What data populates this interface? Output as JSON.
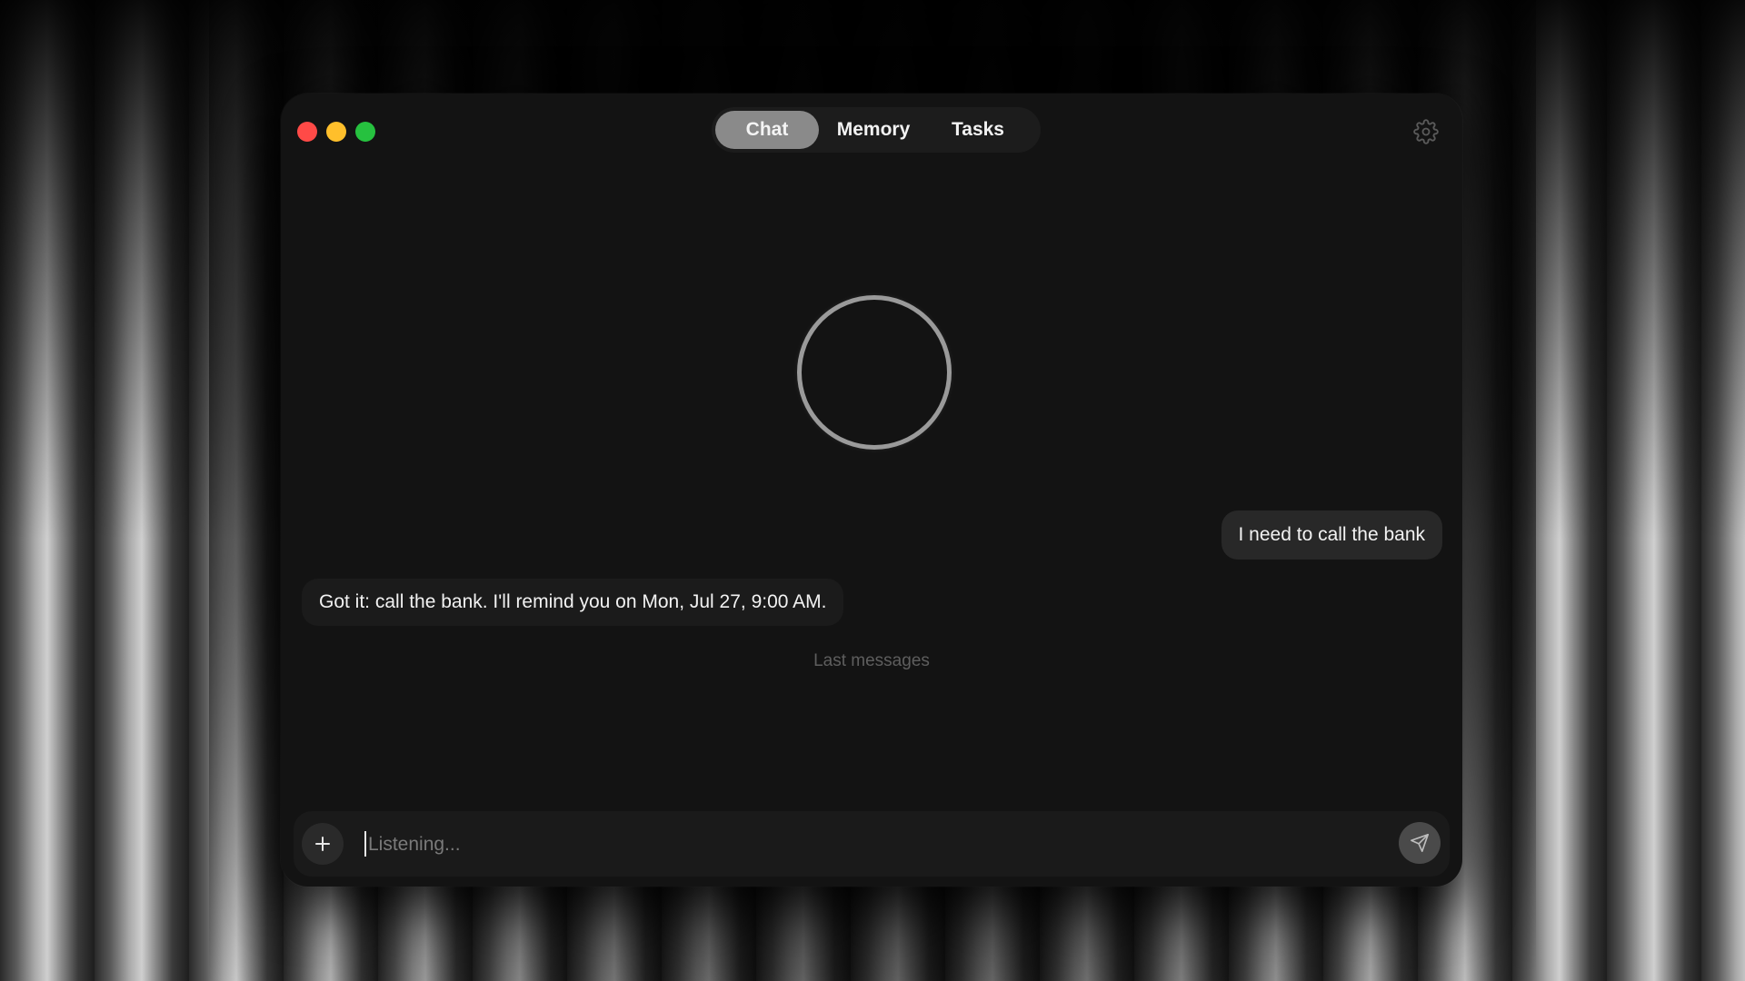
{
  "window": {
    "tabs": [
      {
        "label": "Chat",
        "active": true
      },
      {
        "label": "Memory",
        "active": false
      },
      {
        "label": "Tasks",
        "active": false
      }
    ],
    "settings_icon": "gear-icon"
  },
  "assistant_orb": {
    "state": "listening",
    "icon": "voice-orb-ring"
  },
  "messages": [
    {
      "role": "user",
      "text": "I need to call the bank"
    },
    {
      "role": "assistant",
      "text": "Got it: call the bank. I'll remind you on Mon, Jul 27, 9:00 AM."
    }
  ],
  "history_label": "Last messages",
  "composer": {
    "placeholder": "Listening...",
    "value": "",
    "attach_icon": "plus-icon",
    "send_icon": "send-icon"
  },
  "colors": {
    "close": "#ff4a47",
    "minimize": "#ffbf2b",
    "maximize": "#26c13f",
    "active_tab": "#8a8a8a",
    "window_bg": "#131313"
  }
}
